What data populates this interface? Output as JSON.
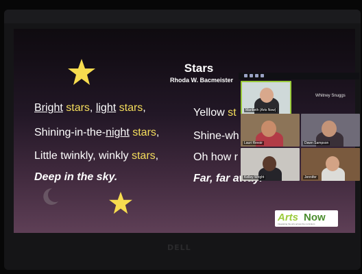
{
  "slide": {
    "title": "Stars",
    "author": "Rhoda W. Bacmeister",
    "left_lines": [
      {
        "segments": [
          "Bright",
          " ",
          "stars",
          ", ",
          "light",
          " ",
          "stars",
          ","
        ]
      },
      {
        "segments": [
          "Shining-in-the-",
          "night",
          " ",
          "stars",
          ","
        ]
      },
      {
        "segments": [
          "Little twinkly, winkly ",
          "stars",
          ","
        ]
      },
      {
        "segments": [
          "Deep in the sky",
          "."
        ]
      }
    ],
    "right_lines": [
      {
        "segments": [
          "Yellow ",
          "st"
        ]
      },
      {
        "segments": [
          "Shine-wh"
        ]
      },
      {
        "segments": [
          "Oh how r"
        ]
      },
      {
        "segments": [
          "Far, far aw",
          "ay",
          "."
        ]
      }
    ],
    "logo": {
      "arts": "Arts",
      "now": "Now",
      "tag": "Integrating the arts across the curriculum"
    }
  },
  "gallery": {
    "tiles": [
      {
        "name": "Maribeth (Arts Now)",
        "bg": "#cfd9d9"
      },
      {
        "name": "Lauri Revoir",
        "bg": "#8c7458"
      },
      {
        "name": "Dawn Sampson",
        "bg": "#6f6b78"
      },
      {
        "name": "Kelley Wright",
        "bg": "#c9c6c1"
      },
      {
        "name": "Jennifer",
        "bg": "#7a5a3e"
      }
    ],
    "viewer": "Whitney Snuggs"
  },
  "monitor": {
    "brand": "DELL"
  },
  "colors": {
    "accent_yellow": "#f6df5c",
    "screen_top": "#0f0b10",
    "screen_bottom": "#5e3f56"
  }
}
